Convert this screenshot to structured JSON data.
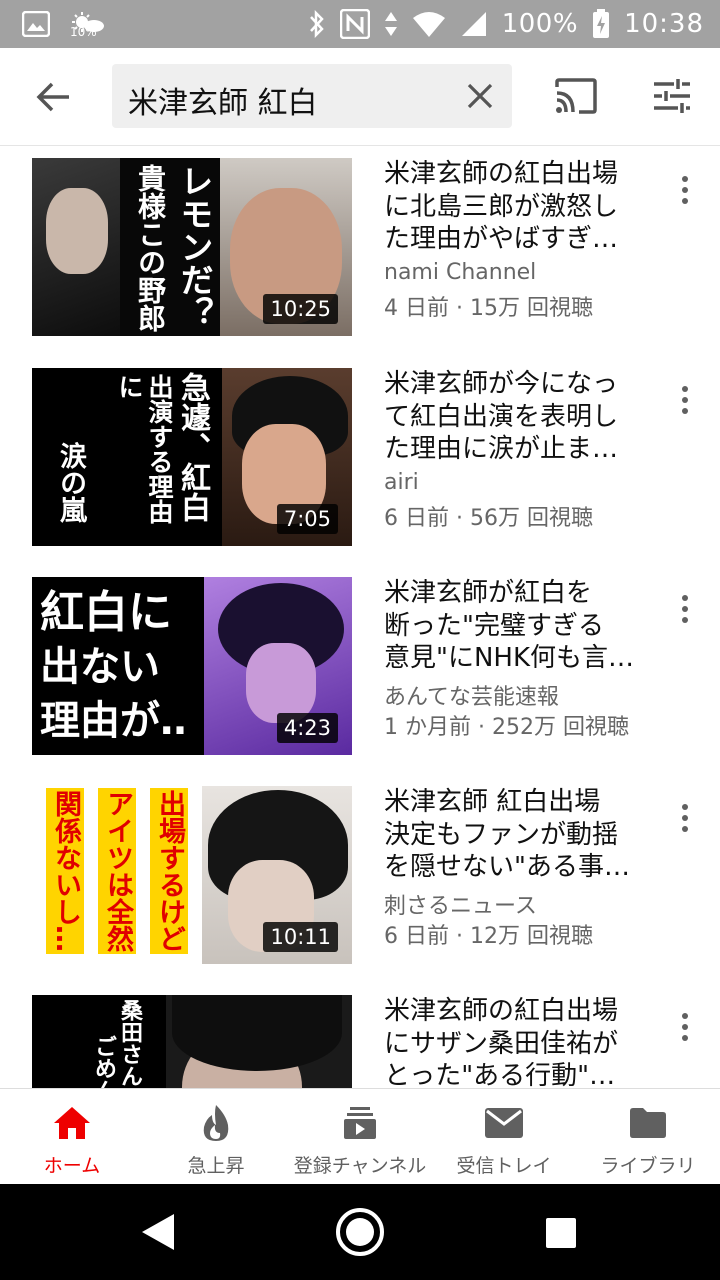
{
  "status_bar": {
    "small_pct": "10%",
    "battery_pct": "100%",
    "time": "10:38"
  },
  "search": {
    "query": "米津玄師 紅白"
  },
  "results": [
    {
      "title_lines": [
        "米津玄師の紅白出場",
        "に北島三郎が激怒し",
        "た理由がやばすぎ…"
      ],
      "channel": "nami Channel",
      "meta": "4 日前 · 15万 回視聴",
      "duration": "10:25",
      "thumb_text": [
        "レモンだ？",
        "貴様この野郎"
      ]
    },
    {
      "title_lines": [
        "米津玄師が今になっ",
        "て紅白出演を表明し",
        "た理由に涙が止ま…"
      ],
      "channel": "airi",
      "meta": "6 日前 · 56万 回視聴",
      "duration": "7:05",
      "thumb_text": [
        "急遽、紅白",
        "出演する理由に",
        "涙の嵐"
      ]
    },
    {
      "title_lines": [
        "米津玄師が紅白を",
        "断った\"完璧すぎる",
        "意見\"にNHK何も言…"
      ],
      "channel": "あんてな芸能速報",
      "meta": "1 か月前 · 252万 回視聴",
      "duration": "4:23",
      "thumb_text": [
        "紅白に",
        "出ない",
        "理由が‥"
      ]
    },
    {
      "title_lines": [
        "米津玄師 紅白出場",
        "決定もファンが動揺",
        "を隠せない\"ある事…"
      ],
      "channel": "刺さるニュース",
      "meta": "6 日前 · 12万 回視聴",
      "duration": "10:11",
      "thumb_text": [
        "出場するけど",
        "アイツは全然",
        "関係ないし…"
      ]
    },
    {
      "title_lines": [
        "米津玄師の紅白出場",
        "にサザン桑田佳祐が",
        "とった\"ある行動\"…"
      ],
      "channel": "",
      "meta": "",
      "duration": "",
      "thumb_text": [
        "桑田さん",
        "ごめん"
      ]
    }
  ],
  "bottom_nav": [
    {
      "label": "ホーム",
      "icon": "home-icon",
      "active": true
    },
    {
      "label": "急上昇",
      "icon": "trending-icon",
      "active": false
    },
    {
      "label": "登録チャンネル",
      "icon": "subscriptions-icon",
      "active": false
    },
    {
      "label": "受信トレイ",
      "icon": "inbox-icon",
      "active": false
    },
    {
      "label": "ライブラリ",
      "icon": "library-icon",
      "active": false
    }
  ],
  "colors": {
    "accent": "#ee0000",
    "status_bar": "#a2a2a2",
    "secondary_text": "#666666"
  }
}
